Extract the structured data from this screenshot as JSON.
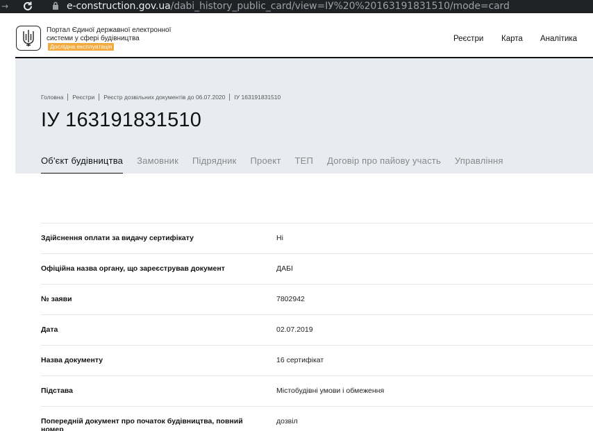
{
  "browser": {
    "url_domain": "e-construction.gov.ua",
    "url_path": "/dabi_history_public_card/view=ІУ%20%20163191831510/mode=card"
  },
  "header": {
    "portal_title": "Портал Єдиної державної електронної системи у сфері будівництва",
    "badge": "Дослідна експлуатація",
    "nav": [
      "Реєстри",
      "Карта",
      "Аналітика"
    ]
  },
  "breadcrumb": [
    "Головна",
    "Реєстри",
    "Реєстр дозвільних документів до 06.07.2020",
    "ІУ 163191831510"
  ],
  "page_title": "ІУ 163191831510",
  "tabs": [
    "Об'єкт будівництва",
    "Замовник",
    "Підрядник",
    "Проект",
    "ТЕП",
    "Договір про пайову участь",
    "Управління"
  ],
  "rows": [
    {
      "label": "Здійснення оплати за видачу сертифікату",
      "value": "Ні"
    },
    {
      "label": "Офіційна назва органу, що зареєстрував документ",
      "value": "ДАБІ"
    },
    {
      "label": "№ заяви",
      "value": "7802942"
    },
    {
      "label": "Дата",
      "value": "02.07.2019"
    },
    {
      "label": "Назва документу",
      "value": "16 сертифікат"
    },
    {
      "label": "Підстава",
      "value": "Містобудівні умови і обмеження"
    },
    {
      "label": "Попередній документ про початок будівництва, повний номер",
      "value": "дозвіл"
    }
  ]
}
